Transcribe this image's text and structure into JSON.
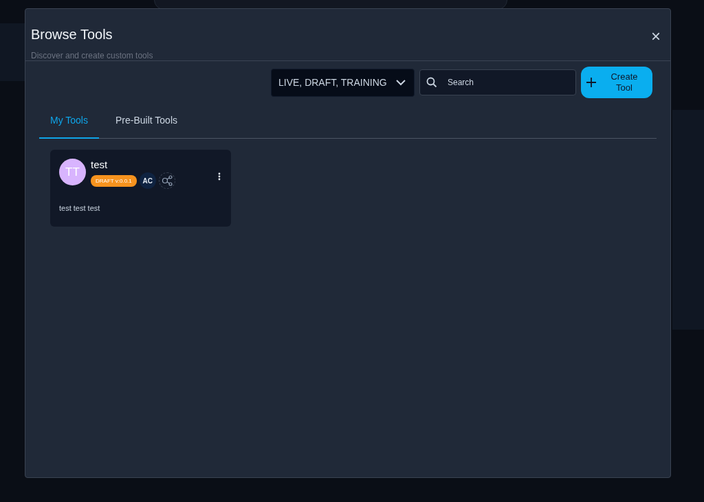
{
  "dialog": {
    "title": "Browse Tools",
    "subtitle": "Discover and create custom tools",
    "close": "×"
  },
  "filter": {
    "value": "LIVE, DRAFT, TRAINING"
  },
  "search": {
    "placeholder": "Search"
  },
  "create_button": {
    "label": "Create Tool"
  },
  "tabs": [
    {
      "label": "My Tools",
      "selected": true
    },
    {
      "label": "Pre-Built Tools",
      "selected": false
    }
  ],
  "tools": [
    {
      "initials": "TT",
      "name": "test",
      "status": "DRAFT v:0.0.1",
      "owner": "AC",
      "description": "test test test"
    }
  ]
}
